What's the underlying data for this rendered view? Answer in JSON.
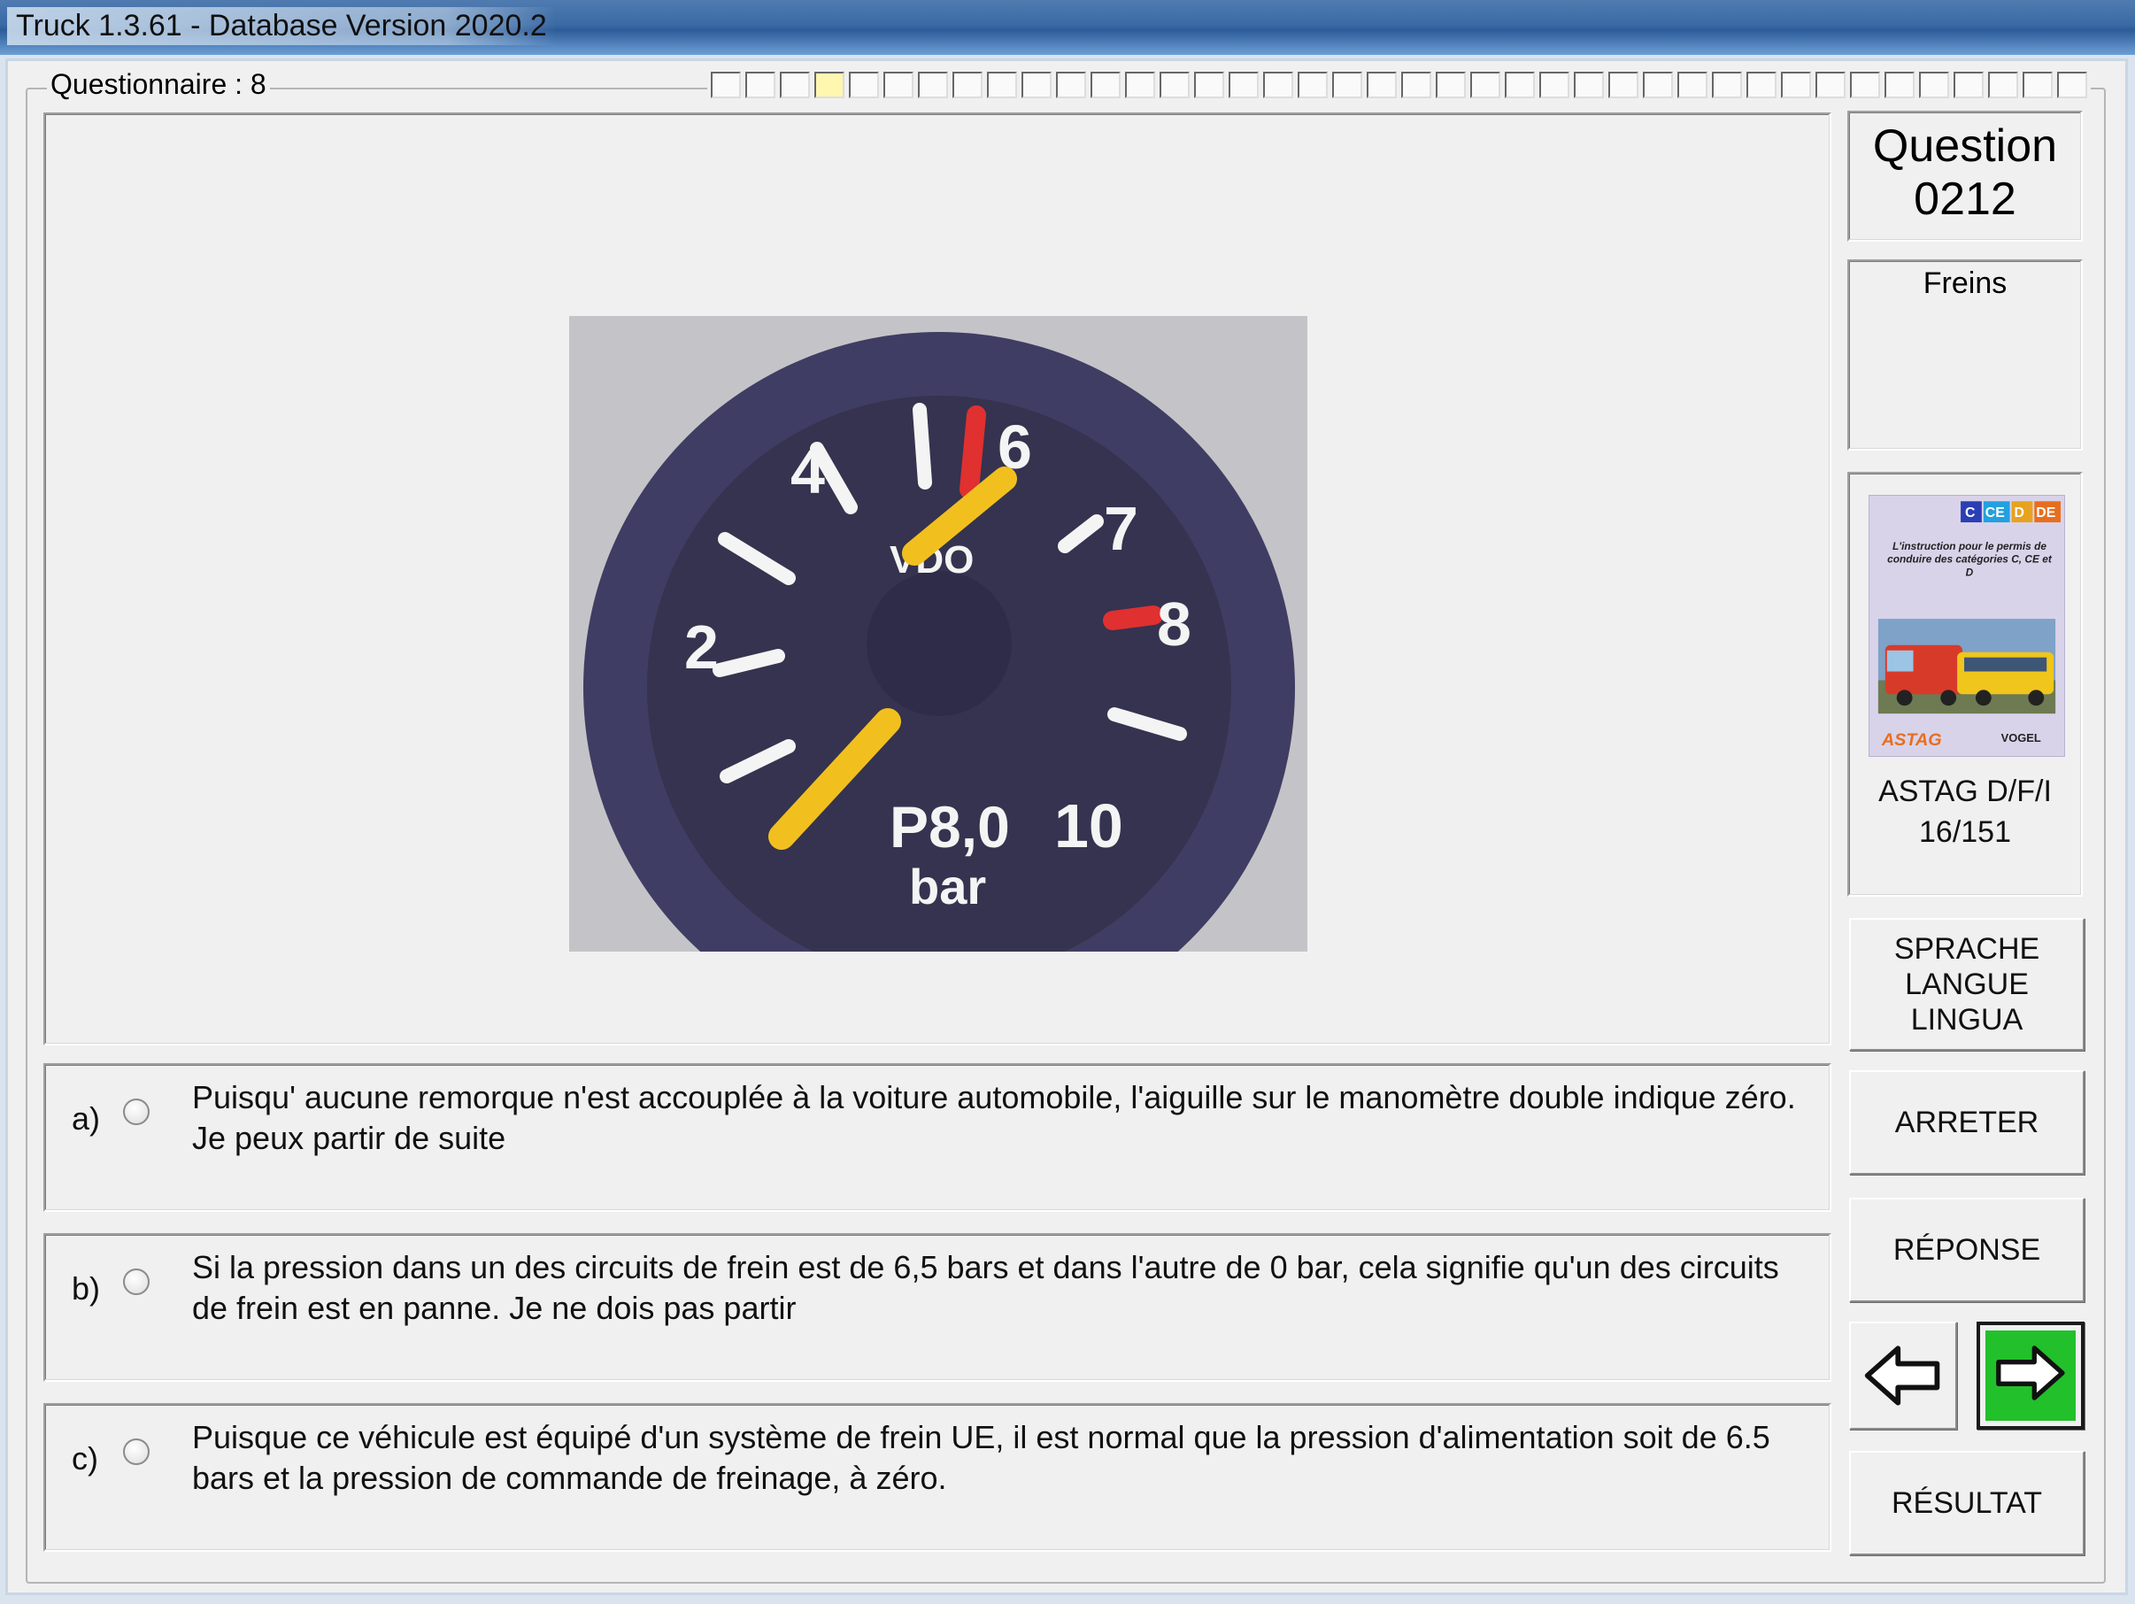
{
  "window": {
    "title": "Truck 1.3.61 - Database Version 2020.2"
  },
  "questionnaire": {
    "label": "Questionnaire : 8",
    "progress_segments": 40,
    "current_segment": 4
  },
  "question": {
    "title_line1": "Question",
    "number": "0212",
    "category": "Freins"
  },
  "gauge_image": {
    "scale_labels": [
      "2",
      "4",
      "6",
      "7",
      "8",
      "10"
    ],
    "center_text": "VDO",
    "label_pressure": "P8,0",
    "label_unit": "bar"
  },
  "answers": [
    {
      "letter": "a)",
      "text": "Puisqu' aucune remorque n'est accouplée à la voiture automobile, l'aiguille sur le manomètre double indique zéro. Je peux partir de suite"
    },
    {
      "letter": "b)",
      "text": "Si la pression dans un des circuits de frein est de 6,5 bars et dans l'autre de 0 bar, cela signifie qu'un des circuits de frein est en panne. Je ne dois pas partir"
    },
    {
      "letter": "c)",
      "text": "Puisque ce véhicule est équipé d'un système de frein UE, il est normal que la pression d'alimentation soit de 6.5 bars et la pression de commande de freinage, à zéro."
    }
  ],
  "book": {
    "badges": [
      "C",
      "CE",
      "D",
      "DE"
    ],
    "cover_title": "L'instruction pour le permis de conduire des catégories C, CE et D",
    "publisher_left": "ASTAG",
    "publisher_right": "VOGEL",
    "caption_line1": "ASTAG D/F/I",
    "caption_line2": "16/151"
  },
  "buttons": {
    "lang_line1": "SPRACHE",
    "lang_line2": "LANGUE",
    "lang_line3": "LINGUA",
    "stop": "ARRETER",
    "answer": "RÉPONSE",
    "result": "RÉSULTAT"
  },
  "colors": {
    "next_button": "#22c02a",
    "needle": "#f2c01e",
    "red_mark": "#e03030",
    "gauge_face": "#3c3a5e"
  }
}
